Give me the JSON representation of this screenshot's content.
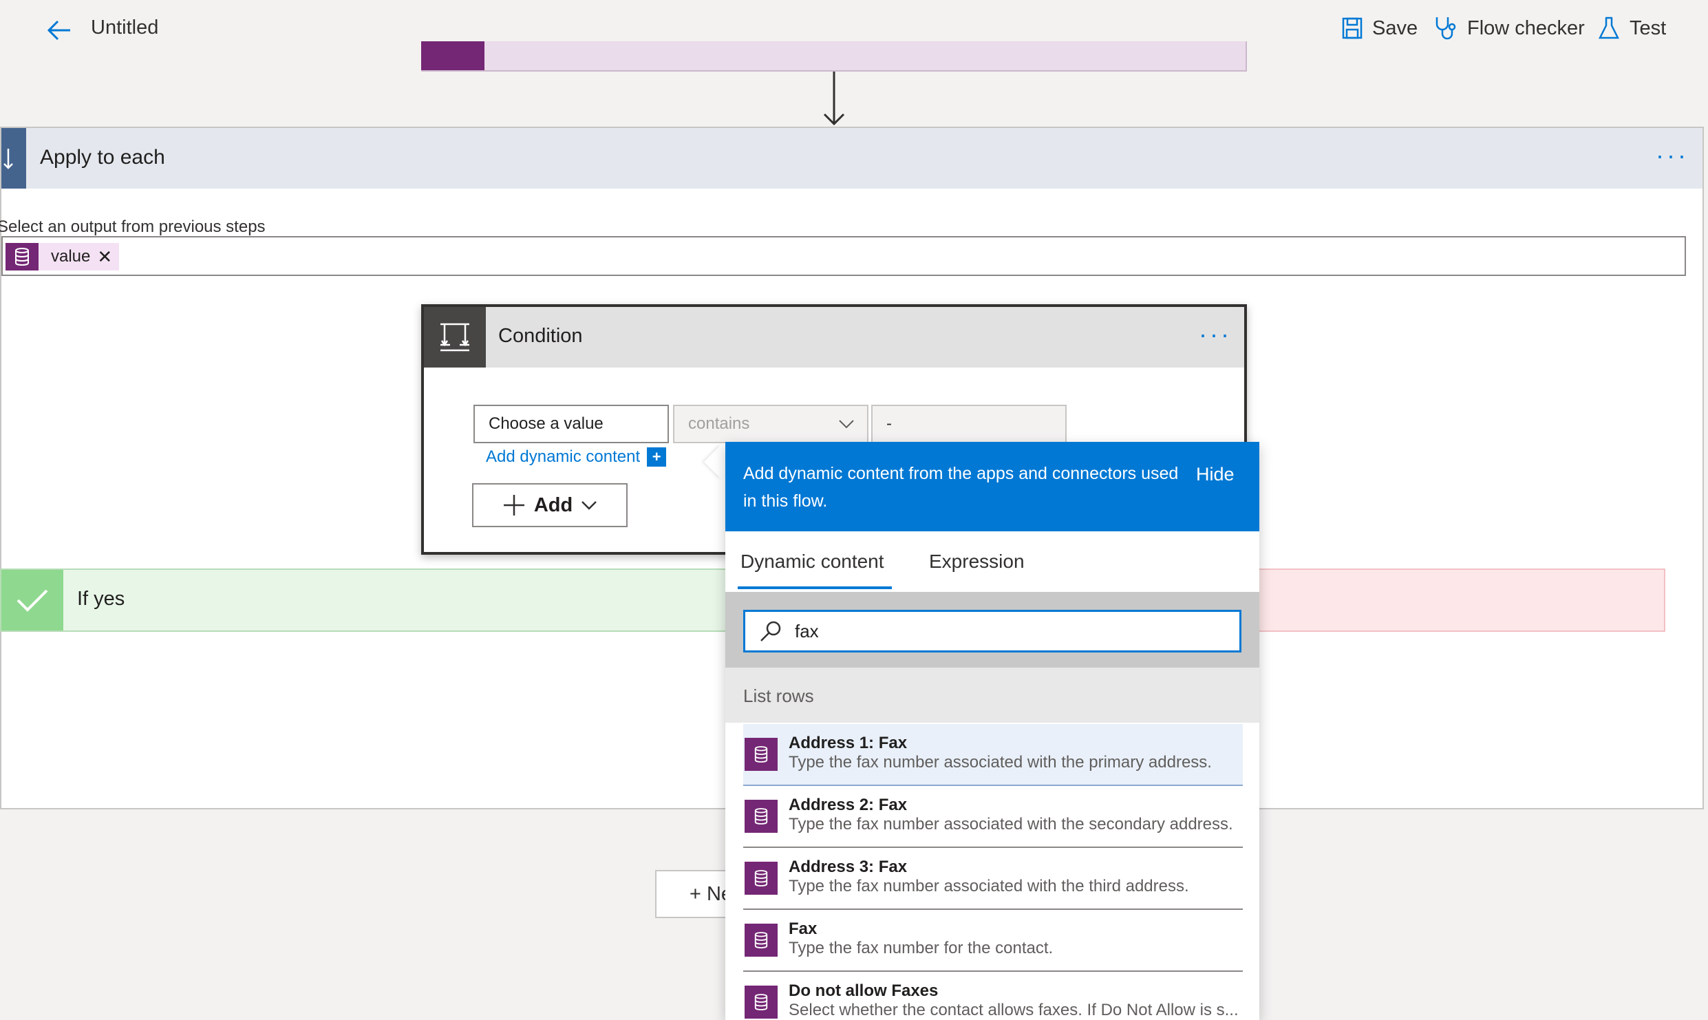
{
  "topbar": {
    "title": "Untitled",
    "save_label": "Save",
    "flow_checker_label": "Flow checker",
    "test_label": "Test"
  },
  "apply_to_each": {
    "title": "Apply to each",
    "select_label": "Select an output from previous steps",
    "token_label": "value",
    "more_label": "···"
  },
  "condition": {
    "title": "Condition",
    "more_label": "···",
    "value_field": "Choose a value",
    "operator": "contains",
    "right_value": "-",
    "add_dynamic_label": "Add dynamic content",
    "add_dynamic_plus": "+",
    "add_button_label": "Add"
  },
  "branches": {
    "if_yes_label": "If yes"
  },
  "new_step": {
    "label": "+ Ne"
  },
  "dynamic_panel": {
    "header_text": "Add dynamic content from the apps and connectors used in this flow.",
    "hide_label": "Hide",
    "tabs": [
      "Dynamic content",
      "Expression"
    ],
    "search_value": "fax",
    "group_label": "List rows",
    "items": [
      {
        "name": "Address 1: Fax",
        "desc": "Type the fax number associated with the primary address."
      },
      {
        "name": "Address 2: Fax",
        "desc": "Type the fax number associated with the secondary address."
      },
      {
        "name": "Address 3: Fax",
        "desc": "Type the fax number associated with the third address."
      },
      {
        "name": "Fax",
        "desc": "Type the fax number for the contact."
      },
      {
        "name": "Do not allow Faxes",
        "desc": "Select whether the contact allows faxes. If Do Not Allow is s..."
      }
    ]
  },
  "colors": {
    "accent": "#0078d4",
    "dataverse": "#742774",
    "apply_header": "#e4e8ee",
    "if_yes": "#e8f6e8",
    "if_no": "#fde7e9"
  }
}
